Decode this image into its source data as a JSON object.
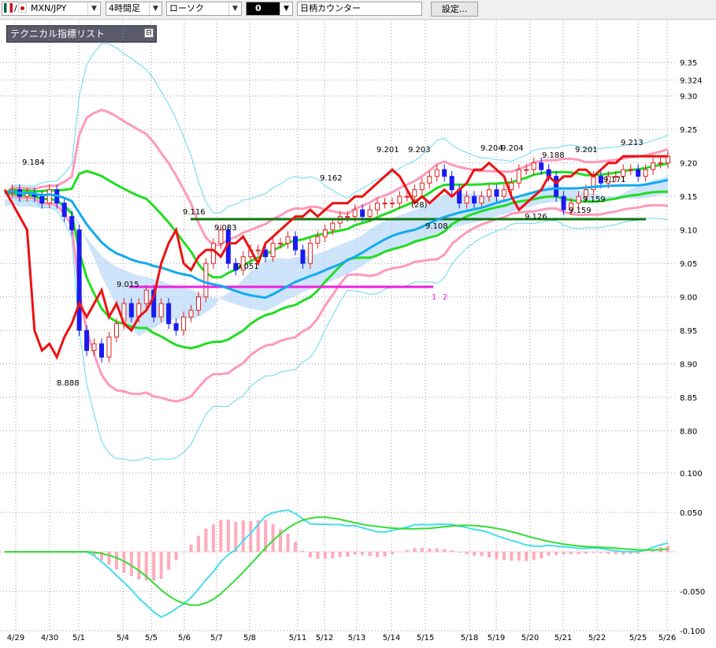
{
  "toolbar": {
    "pair_label": "MXN/JPY",
    "timeframe": "4時間足",
    "chart_style": "ローソク",
    "number_field": "0",
    "counter_field": "日柄カウンター",
    "settings_label": "設定..."
  },
  "legend_panel": {
    "title": "テクニカル指標リスト",
    "control": "⊟"
  },
  "colors": {
    "up_candle": "#e02020",
    "down_candle": "#1a1af0",
    "ma_red": "#ee1111",
    "bb_green": "#22dd22",
    "bb_pink": "#ff99bb",
    "bb_outer": "#66d8f0",
    "ma_cyan": "#11aaee",
    "ichimoku_cloud": "#b8d8f8",
    "level_magenta": "#ee22dd",
    "level_green": "#117711",
    "macd_hist": "#ffaabb"
  },
  "chart_data": [
    {
      "type": "candlestick",
      "y_ticks": [
        "9.35",
        "9.324",
        "9.30",
        "9.25",
        "9.20",
        "9.15",
        "9.10",
        "9.05",
        "9.00",
        "8.95",
        "8.90",
        "8.85",
        "8.80"
      ],
      "ylim": [
        8.77,
        9.375
      ],
      "x_ticks": [
        "4/29",
        "4/30",
        "5/1",
        "5/4",
        "5/5",
        "5/6",
        "5/7",
        "5/8",
        "5/11",
        "5/12",
        "5/13",
        "5/14",
        "5/15",
        "5/18",
        "5/19",
        "5/20",
        "5/21",
        "5/22",
        "5/25",
        "5/26"
      ],
      "annotations": [
        "9.184",
        "8.888",
        "9.015",
        "9.116",
        "9.083",
        "9.051",
        "9.162",
        "9.201",
        "9.203",
        "9.108",
        "(28)",
        "9.204",
        "9.204",
        "9.188",
        "9.201",
        "9.213",
        "9.171",
        "9.159",
        "9.126",
        "9.159",
        "1",
        "2"
      ],
      "levels": [
        {
          "value": 9.015,
          "color": "magenta",
          "from": "5/4",
          "to": "5/15"
        },
        {
          "value": 9.116,
          "color": "green",
          "from": "5/6",
          "to": "5/25"
        }
      ],
      "close_series": [
        9.155,
        9.16,
        9.15,
        9.155,
        9.15,
        9.14,
        9.16,
        9.14,
        9.12,
        9.1,
        8.95,
        8.92,
        8.93,
        8.91,
        8.94,
        8.96,
        8.99,
        8.97,
        8.99,
        9.01,
        8.97,
        8.99,
        8.96,
        8.95,
        8.97,
        8.98,
        9.0,
        9.05,
        9.08,
        9.1,
        9.05,
        9.04,
        9.06,
        9.07,
        9.07,
        9.06,
        9.08,
        9.08,
        9.09,
        9.07,
        9.05,
        9.08,
        9.09,
        9.1,
        9.11,
        9.12,
        9.12,
        9.13,
        9.12,
        9.13,
        9.14,
        9.14,
        9.14,
        9.15,
        9.15,
        9.16,
        9.17,
        9.18,
        9.19,
        9.18,
        9.16,
        9.14,
        9.15,
        9.14,
        9.15,
        9.16,
        9.15,
        9.16,
        9.17,
        9.19,
        9.19,
        9.2,
        9.19,
        9.18,
        9.15,
        9.13,
        9.14,
        9.15,
        9.16,
        9.18,
        9.17,
        9.18,
        9.18,
        9.19,
        9.19,
        9.18,
        9.19,
        9.2,
        9.2,
        9.21
      ]
    },
    {
      "type": "line",
      "y_ticks": [
        "0.100",
        "0.050",
        "-0.050",
        "-0.100"
      ],
      "ylim": [
        -0.1,
        0.1
      ]
    }
  ]
}
